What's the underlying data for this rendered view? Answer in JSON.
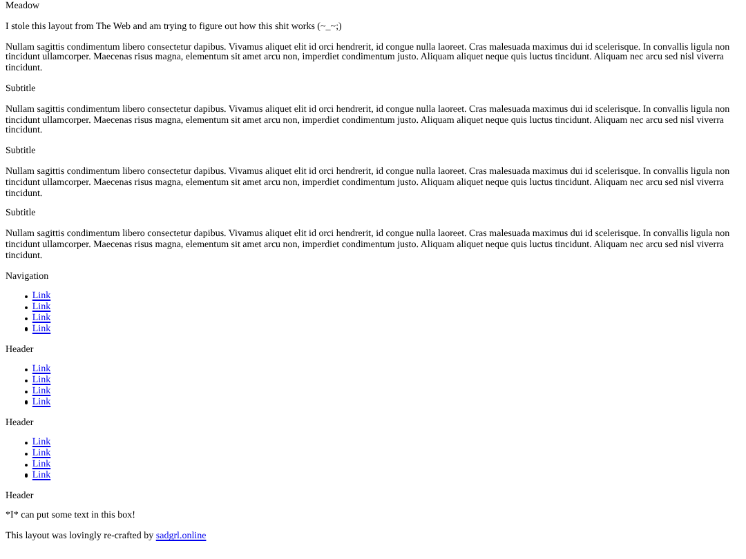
{
  "title": "Meadow",
  "intro": "I stole this layout from The Web and am trying to figure out how this shit works (~_~;)",
  "sections": [
    {
      "kind": "paragraph",
      "text": "Nullam sagittis condimentum libero consectetur dapibus. Vivamus aliquet elit id orci hendrerit, id congue nulla laoreet. Cras malesuada maximus dui id scelerisque. In convallis ligula non tincidunt ullamcorper. Maecenas risus magna, elementum sit amet arcu non, imperdiet condimentum justo. Aliquam aliquet neque quis luctus tincidunt. Aliquam nec arcu sed nisl viverra tincidunt."
    },
    {
      "kind": "heading",
      "text": "Subtitle"
    },
    {
      "kind": "paragraph",
      "text": "Nullam sagittis condimentum libero consectetur dapibus. Vivamus aliquet elit id orci hendrerit, id congue nulla laoreet. Cras malesuada maximus dui id scelerisque. In convallis ligula non tincidunt ullamcorper. Maecenas risus magna, elementum sit amet arcu non, imperdiet condimentum justo. Aliquam aliquet neque quis luctus tincidunt. Aliquam nec arcu sed nisl viverra tincidunt."
    },
    {
      "kind": "heading",
      "text": "Subtitle"
    },
    {
      "kind": "paragraph",
      "text": "Nullam sagittis condimentum libero consectetur dapibus. Vivamus aliquet elit id orci hendrerit, id congue nulla laoreet. Cras malesuada maximus dui id scelerisque. In convallis ligula non tincidunt ullamcorper. Maecenas risus magna, elementum sit amet arcu non, imperdiet condimentum justo. Aliquam aliquet neque quis luctus tincidunt. Aliquam nec arcu sed nisl viverra tincidunt."
    },
    {
      "kind": "heading",
      "text": "Subtitle"
    },
    {
      "kind": "paragraph",
      "text": "Nullam sagittis condimentum libero consectetur dapibus. Vivamus aliquet elit id orci hendrerit, id congue nulla laoreet. Cras malesuada maximus dui id scelerisque. In convallis ligula non tincidunt ullamcorper. Maecenas risus magna, elementum sit amet arcu non, imperdiet condimentum justo. Aliquam aliquet neque quis luctus tincidunt. Aliquam nec arcu sed nisl viverra tincidunt."
    },
    {
      "kind": "heading",
      "text": "Navigation"
    },
    {
      "kind": "links",
      "items": [
        "Link",
        "Link",
        "Link",
        "Link"
      ]
    },
    {
      "kind": "heading",
      "text": "Header"
    },
    {
      "kind": "links",
      "items": [
        "Link",
        "Link",
        "Link",
        "Link"
      ]
    },
    {
      "kind": "heading",
      "text": "Header"
    },
    {
      "kind": "links",
      "items": [
        "Link",
        "Link",
        "Link",
        "Link"
      ]
    },
    {
      "kind": "heading",
      "text": "Header"
    },
    {
      "kind": "paragraph",
      "text": "*I* can put some text in this box!"
    }
  ],
  "footer": {
    "text": "This layout was lovingly re-crafted by",
    "link": "sadgrl.online"
  }
}
